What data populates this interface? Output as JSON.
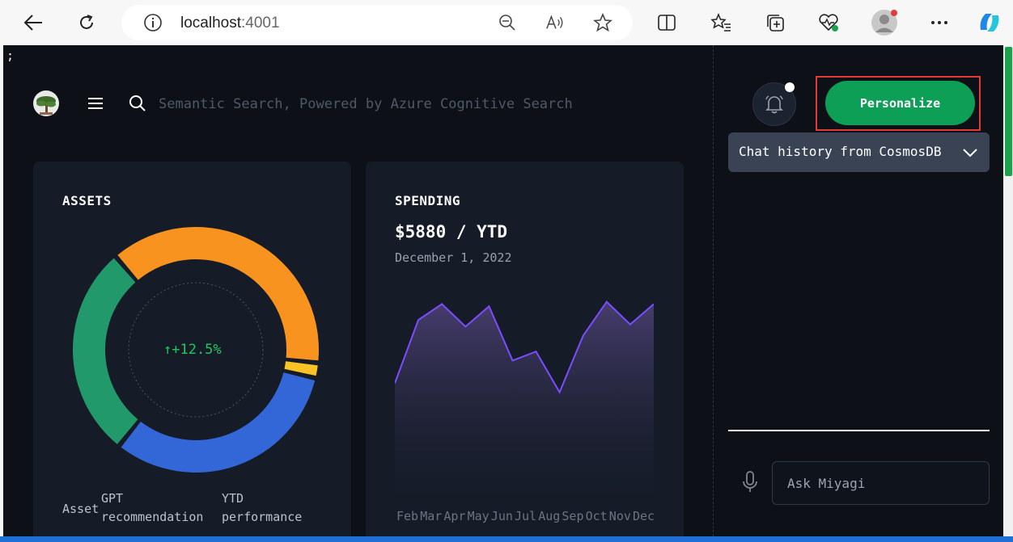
{
  "browser": {
    "url_host": "localhost",
    "url_port": ":4001",
    "icons": [
      "back-arrow-icon",
      "refresh-icon",
      "info-icon",
      "zoom-out-icon",
      "read-aloud-icon",
      "favorite-star-icon",
      "split-screen-icon",
      "favorites-list-icon",
      "collections-icon",
      "browser-health-icon",
      "profile-avatar",
      "more-options-icon",
      "copilot-icon"
    ]
  },
  "app": {
    "stray_text": ";",
    "search": {
      "placeholder": "Semantic Search, Powered by Azure Cognitive Search"
    },
    "assets": {
      "title": "ASSETS",
      "growth": "↑+12.5%",
      "legend": [
        "Asset",
        "GPT recommendation",
        "YTD performance"
      ],
      "donut": [
        {
          "name": "orange",
          "value": 38,
          "color": "#f7931e"
        },
        {
          "name": "yellow",
          "value": 2,
          "color": "#f7c325"
        },
        {
          "name": "blue",
          "value": 32,
          "color": "#3366d6"
        },
        {
          "name": "green",
          "value": 28,
          "color": "#21996a"
        }
      ]
    },
    "spending": {
      "title": "SPENDING",
      "amount": "$5880 / YTD",
      "date": "December 1, 2022",
      "months": [
        "Feb",
        "Mar",
        "Apr",
        "May",
        "Jun",
        "Jul",
        "Aug",
        "Sep",
        "Oct",
        "Nov",
        "Dec"
      ]
    },
    "chat": {
      "personalize_label": "Personalize",
      "history_label": "Chat history from CosmosDB",
      "ask_placeholder": "Ask Miyagi"
    }
  },
  "chart_data": {
    "type": "area",
    "x": [
      "Feb",
      "Mar",
      "Apr",
      "May",
      "Jun",
      "Jul",
      "Aug",
      "Sep",
      "Oct",
      "Nov",
      "Dec"
    ],
    "series": [
      {
        "values": [
          52,
          80,
          87,
          77,
          86,
          62,
          66,
          48,
          73,
          88,
          78,
          87
        ]
      }
    ],
    "ylim": [
      0,
      100
    ],
    "line_color": "#7c4dff"
  },
  "colors": {
    "accent": "#0e9f56",
    "background": "#0d1117",
    "card": "#151c28"
  }
}
